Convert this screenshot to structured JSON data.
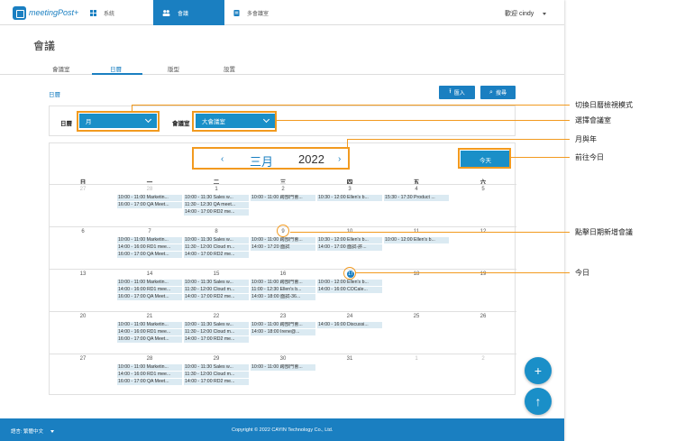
{
  "app": {
    "logo_text": "meetingPost+",
    "nav": [
      {
        "label": "系統",
        "icon": "grid-icon"
      },
      {
        "label": "會議",
        "icon": "people-icon"
      },
      {
        "label": "多會議室",
        "icon": "doc-icon"
      }
    ],
    "user": "歡迎 cindy"
  },
  "page": {
    "title": "會議",
    "tabs": [
      "會議室",
      "日曆",
      "版型",
      "設置"
    ],
    "section": "日曆",
    "import_label": "匯入",
    "search_label": "搜尋"
  },
  "filter": {
    "cal_label": "日曆",
    "cal_value": "月",
    "room_label": "會議室",
    "room_value": "大會議室"
  },
  "calendar": {
    "month": "三月",
    "year": "2022",
    "today_label": "今天",
    "dow": [
      "日",
      "一",
      "二",
      "三",
      "四",
      "五",
      "六"
    ],
    "weeks": [
      {
        "days": [
          {
            "d": "27",
            "o": true
          },
          {
            "d": "28",
            "o": true
          },
          {
            "d": "1"
          },
          {
            "d": "2"
          },
          {
            "d": "3"
          },
          {
            "d": "4"
          },
          {
            "d": "5"
          }
        ],
        "events": [
          [],
          [
            "10:00 - 11:00 Marketin...",
            "16:00 - 17:00 QA Meet..."
          ],
          [
            "10:00 - 11:30 Sales w...",
            "11:30 - 12:30 QA meet...",
            "14:00 - 17:00 RD2 me..."
          ],
          [
            "10:00 - 11:00 跨部門會..."
          ],
          [
            "10:30 - 12:00 Ellen's b..."
          ],
          [
            "15:30 - 17:30 Product ..."
          ],
          []
        ]
      },
      {
        "days": [
          {
            "d": "6"
          },
          {
            "d": "7"
          },
          {
            "d": "8"
          },
          {
            "d": "9"
          },
          {
            "d": "10"
          },
          {
            "d": "11"
          },
          {
            "d": "12"
          }
        ],
        "events": [
          [],
          [
            "10:00 - 11:00 Marketin...",
            "14:00 - 16:00 RD1 mee...",
            "16:00 - 17:00 QA Meet..."
          ],
          [
            "10:00 - 11:30 Sales w...",
            "11:30 - 12:00 Cloud m...",
            "14:00 - 17:00 RD2 me..."
          ],
          [
            "10:00 - 11:00 跨部門會...",
            "14:00 - 17:20 面試"
          ],
          [
            "10:30 - 12:00 Ellen's b...",
            "14:00 - 17:00 面試-許..."
          ],
          [
            "10:00 - 12:00 Ellen's b..."
          ],
          []
        ]
      },
      {
        "days": [
          {
            "d": "13"
          },
          {
            "d": "14"
          },
          {
            "d": "15"
          },
          {
            "d": "16"
          },
          {
            "d": "17"
          },
          {
            "d": "18"
          },
          {
            "d": "19"
          }
        ],
        "events": [
          [],
          [
            "10:00 - 11:00 Marketin...",
            "14:00 - 16:00 RD1 mee...",
            "16:00 - 17:00 QA Meet..."
          ],
          [
            "10:00 - 11:30 Sales w...",
            "11:30 - 12:00 Cloud m...",
            "14:00 - 17:00 RD2 me..."
          ],
          [
            "10:00 - 11:00 跨部門會...",
            "11:00 - 12:30 Ellen's b...",
            "14:00 - 18:00 面試-36..."
          ],
          [
            "10:00 - 12:00 Ellen's b...",
            "14:00 - 16:00 COCale..."
          ],
          [],
          []
        ]
      },
      {
        "days": [
          {
            "d": "20"
          },
          {
            "d": "21"
          },
          {
            "d": "22"
          },
          {
            "d": "23"
          },
          {
            "d": "24"
          },
          {
            "d": "25"
          },
          {
            "d": "26"
          }
        ],
        "events": [
          [],
          [
            "10:00 - 11:00 Marketin...",
            "14:00 - 16:00 RD1 mee...",
            "16:00 - 17:00 QA Meet..."
          ],
          [
            "10:00 - 11:30 Sales w...",
            "11:30 - 12:00 Cloud m...",
            "14:00 - 17:00 RD2 me..."
          ],
          [
            "10:00 - 11:00 跨部門會...",
            "14:00 - 18:00 Irene@..."
          ],
          [
            "14:00 - 16:00 Discussi..."
          ],
          [],
          []
        ]
      },
      {
        "days": [
          {
            "d": "27"
          },
          {
            "d": "28"
          },
          {
            "d": "29"
          },
          {
            "d": "30"
          },
          {
            "d": "31"
          },
          {
            "d": "1",
            "o": true
          },
          {
            "d": "2",
            "o": true
          }
        ],
        "events": [
          [],
          [
            "10:00 - 11:00 Marketin...",
            "14:00 - 16:00 RD1 mee...",
            "16:00 - 17:00 QA Meet..."
          ],
          [
            "10:00 - 11:30 Sales w...",
            "11:30 - 12:00 Cloud m...",
            "14:00 - 17:00 RD2 me..."
          ],
          [
            "10:00 - 11:00 跨部門會..."
          ],
          [],
          [],
          []
        ]
      }
    ]
  },
  "footer": {
    "lang": "語言: 繁體中文",
    "copyright": "Copyright © 2022 CAYIN Technology Co., Ltd."
  },
  "annotations": [
    "切換日曆檢視模式",
    "選擇會議室",
    "月與年",
    "前往今日",
    "點擊日期新增會議",
    "今日"
  ],
  "colors": {
    "primary": "#1a7fc1",
    "highlight": "#f29a1f",
    "event_bg": "#dbeaf2"
  }
}
